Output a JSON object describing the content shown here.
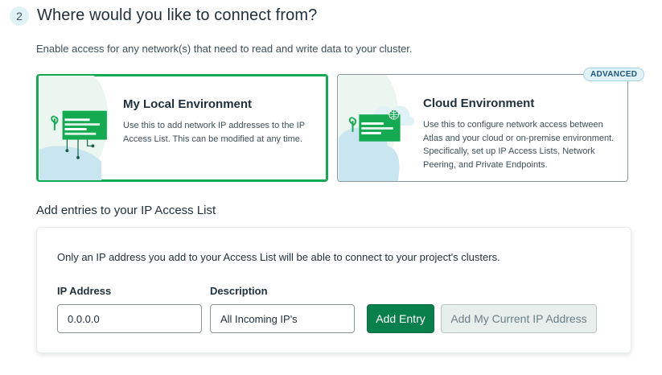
{
  "step": {
    "number": "2",
    "title": "Where would you like to connect from?",
    "subtitle": "Enable access for any network(s) that need to read and write data to your cluster."
  },
  "options": {
    "local": {
      "title": "My Local Environment",
      "description": "Use this to add network IP addresses to the IP Access List. This can be modified at any time.",
      "selected": true
    },
    "cloud": {
      "title": "Cloud Environment",
      "description": "Use this to configure network access between Atlas and your cloud or on-premise environment. Specifically, set up IP Access Lists, Network Peering, and Private Endpoints.",
      "badge": "ADVANCED",
      "selected": false
    }
  },
  "access_list": {
    "section_title": "Add entries to your IP Access List",
    "info_text": "Only an IP address you add to your Access List will be able to connect to your project's clusters.",
    "ip_label": "IP Address",
    "ip_value": "0.0.0.0",
    "description_label": "Description",
    "description_value": "All Incoming IP's",
    "add_entry_label": "Add Entry",
    "add_current_ip_label": "Add My Current IP Address"
  },
  "colors": {
    "brand_green": "#13aa52",
    "button_green": "#09804c",
    "badge_blue_bg": "#e1f2f6",
    "text": "#21313c"
  },
  "icons": {
    "local": "local-environment-illustration",
    "cloud": "cloud-environment-illustration"
  }
}
